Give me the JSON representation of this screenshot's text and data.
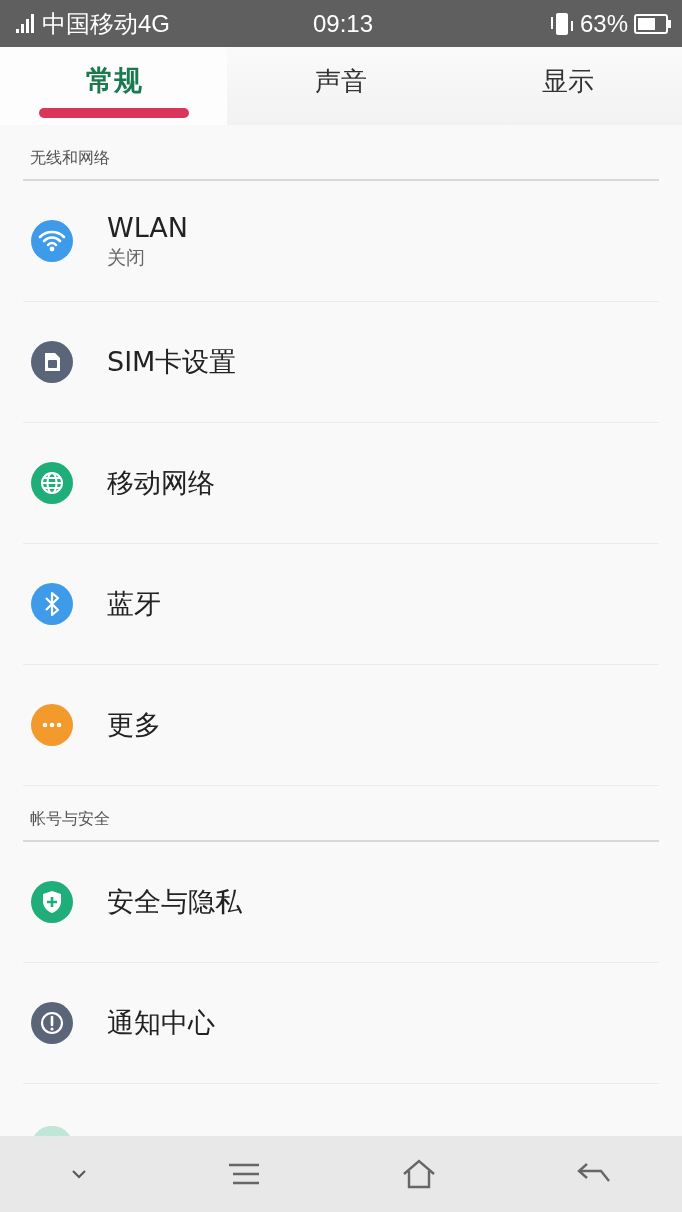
{
  "status_bar": {
    "carrier": "中国移动4G",
    "time": "09:13",
    "battery": "63%"
  },
  "tabs": [
    {
      "label": "常规",
      "selected": true
    },
    {
      "label": "声音",
      "selected": false
    },
    {
      "label": "显示",
      "selected": false
    }
  ],
  "sections": [
    {
      "title": "无线和网络",
      "items": [
        {
          "kind": "wifi",
          "color": "#3d9be9",
          "title": "WLAN",
          "subtitle": "关闭"
        },
        {
          "kind": "sim",
          "color": "#5b6579",
          "title": "SIM卡设置"
        },
        {
          "kind": "globe",
          "color": "#1fae7a",
          "title": "移动网络"
        },
        {
          "kind": "bluetooth",
          "color": "#3d9be9",
          "title": "蓝牙"
        },
        {
          "kind": "more",
          "color": "#f39a2c",
          "title": "更多"
        }
      ]
    },
    {
      "title": "帐号与安全",
      "items": [
        {
          "kind": "shield",
          "color": "#1fae7a",
          "title": "安全与隐私"
        },
        {
          "kind": "alert",
          "color": "#5b6579",
          "title": "通知中心"
        }
      ]
    }
  ]
}
